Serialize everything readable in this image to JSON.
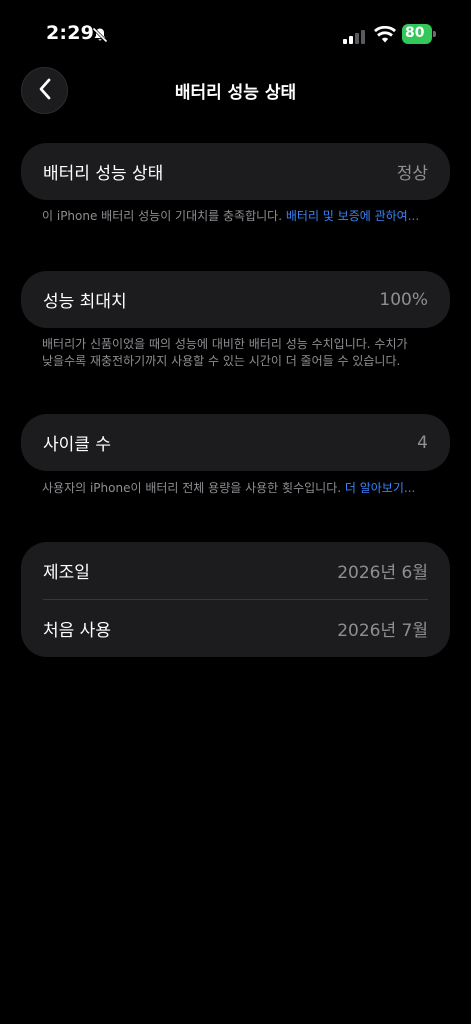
{
  "status_bar": {
    "time": "2:29",
    "battery_level": "80",
    "icons": [
      "bell-slash-icon",
      "cellular-signal-icon",
      "wifi-icon",
      "battery-icon"
    ]
  },
  "nav": {
    "title": "배터리 성능 상태",
    "back_icon": "chevron-left-icon"
  },
  "battery_health": {
    "label": "배터리 성능 상태",
    "value": "정상",
    "footnote_text": "이 iPhone 배터리 성능이 기대치를 충족합니다. ",
    "footnote_link": "배터리 및 보증에 관하여..."
  },
  "max_capacity": {
    "label": "성능 최대치",
    "value": "100%",
    "footnote_text": "배터리가 신품이었을 때의 성능에 대비한 배터리 성능 수치입니다. 수치가 낮을수록 재충전하기까지 사용할 수 있는 시간이 더 줄어들 수 있습니다."
  },
  "cycle_count": {
    "label": "사이클 수",
    "value": "4",
    "footnote_text": "사용자의 iPhone이 배터리 전체 용량을 사용한 횟수입니다. ",
    "footnote_link": "더 알아보기..."
  },
  "dates": {
    "manufacture_label": "제조일",
    "manufacture_value": "2026년 6월",
    "first_use_label": "처음 사용",
    "first_use_value": "2026년 7월"
  },
  "colors": {
    "background": "#000000",
    "card": "#1c1c1e",
    "secondary_text": "#8e8e93",
    "link": "#3b82f6",
    "battery_green": "#34c759"
  }
}
